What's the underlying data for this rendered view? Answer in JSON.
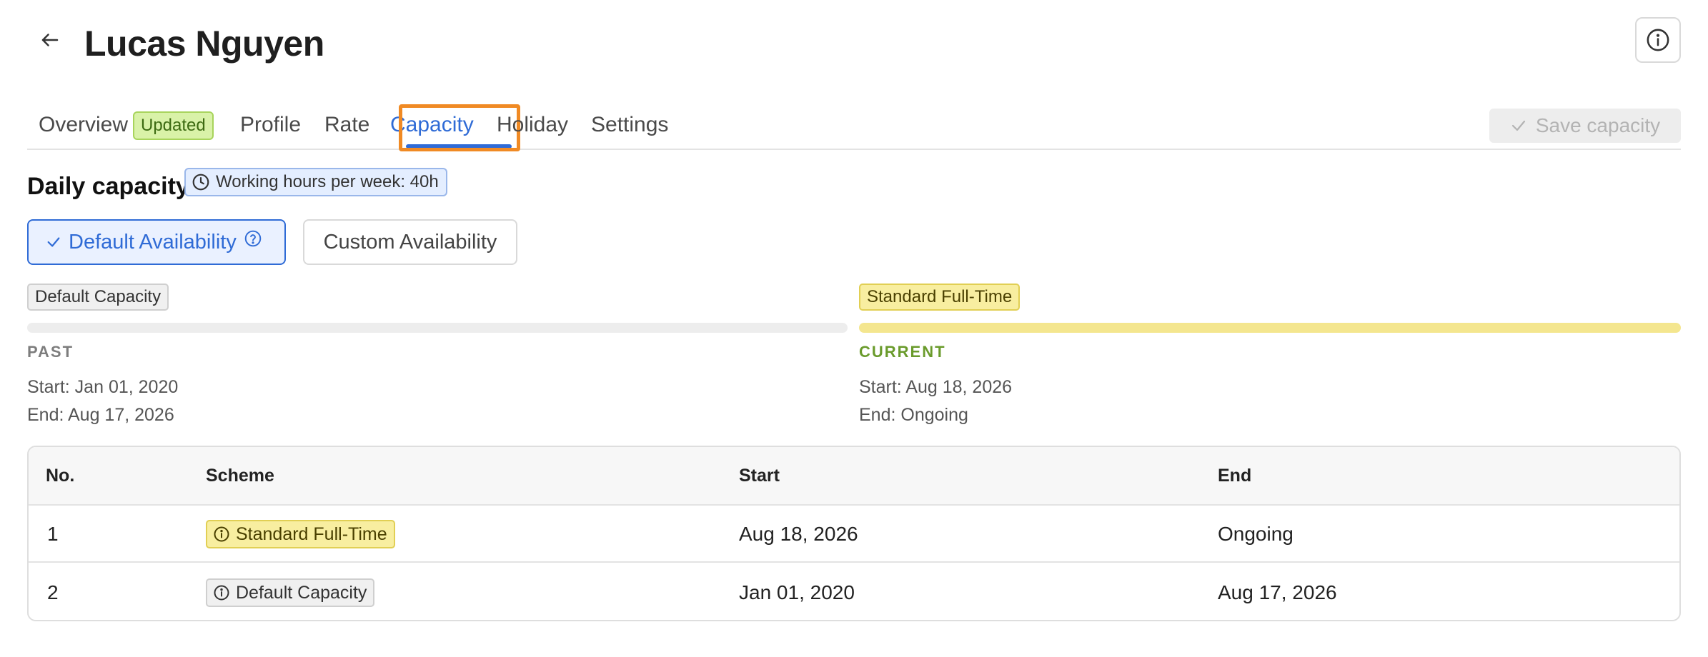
{
  "header": {
    "title": "Lucas Nguyen",
    "back_icon": "arrow-left-icon",
    "info_icon": "info-circle-icon"
  },
  "tabs": [
    {
      "label": "Overview",
      "badge": "Updated",
      "active": false
    },
    {
      "label": "Profile",
      "active": false
    },
    {
      "label": "Rate",
      "active": false
    },
    {
      "label": "Capacity",
      "active": true
    },
    {
      "label": "Holiday",
      "active": false
    },
    {
      "label": "Settings",
      "active": false
    }
  ],
  "toolbar": {
    "save_label": "Save capacity",
    "save_icon": "check-icon",
    "save_disabled": true
  },
  "daily_capacity": {
    "title": "Daily capacity",
    "hours_badge": "Working hours per week: 40h",
    "hours_icon": "clock-icon",
    "availability": {
      "default_label": "Default Availability",
      "default_selected": true,
      "custom_label": "Custom Availability"
    }
  },
  "timeline": {
    "past": {
      "chip": "Default Capacity",
      "phase": "PAST",
      "start": "Start: Jan 01, 2020",
      "end": "End: Aug 17, 2026"
    },
    "current": {
      "chip": "Standard Full-Time",
      "phase": "CURRENT",
      "start": "Start: Aug 18, 2026",
      "end": "End: Ongoing"
    }
  },
  "table": {
    "headers": [
      "No.",
      "Scheme",
      "Start",
      "End"
    ],
    "rows": [
      {
        "no": "1",
        "scheme": "Standard Full-Time",
        "start": "Aug 18, 2026",
        "end": "Ongoing"
      },
      {
        "no": "2",
        "scheme": "Default Capacity",
        "start": "Jan 01, 2020",
        "end": "Aug 17, 2026"
      }
    ]
  },
  "colors": {
    "accent": "#2f6bd6",
    "highlight": "#f08a24",
    "current_yellow": "#f4e68f",
    "current_label_green": "#6a9b2c",
    "updated_badge_bg": "#d9f2a8"
  }
}
